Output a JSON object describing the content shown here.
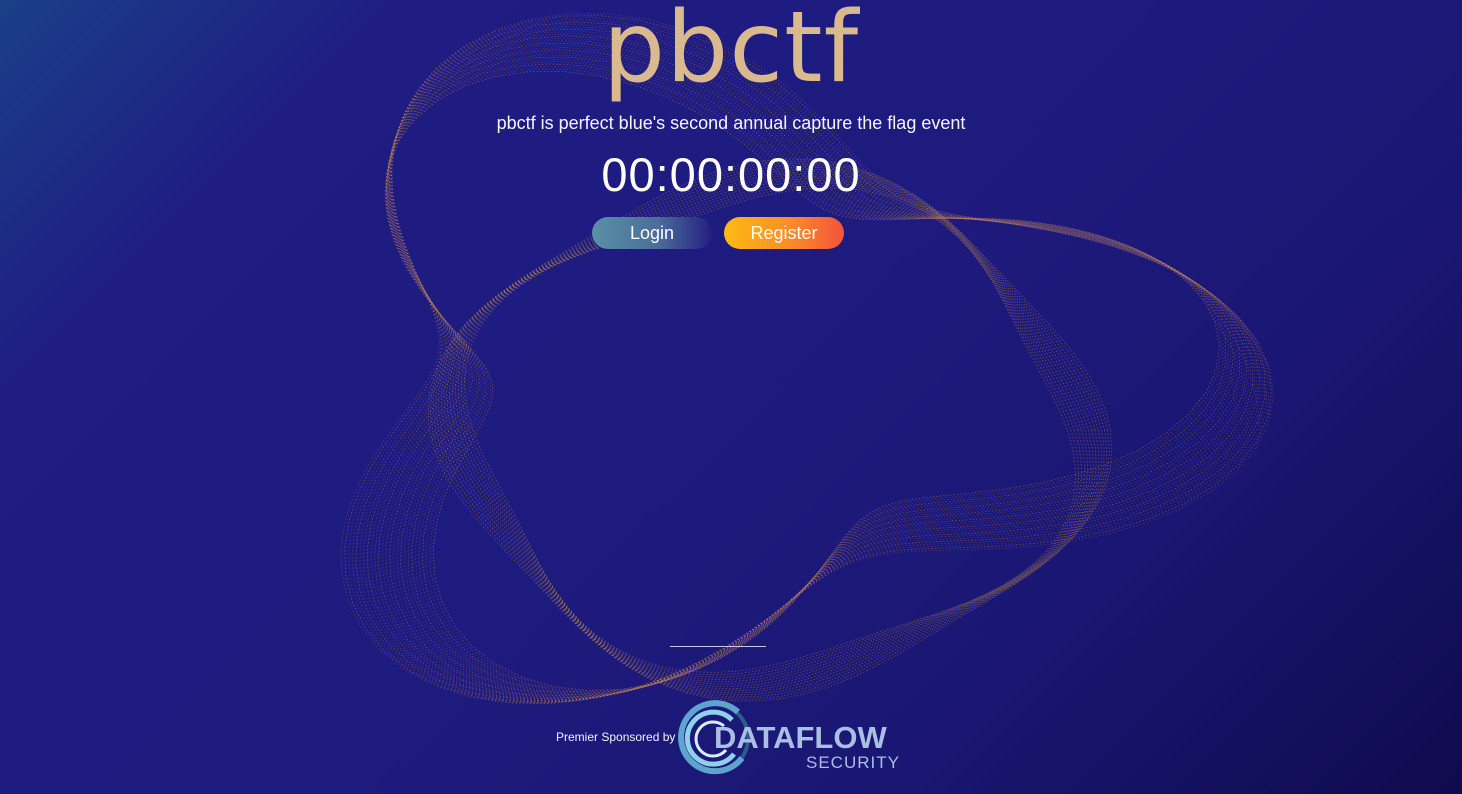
{
  "hero": {
    "title": "pbctf",
    "subtitle": "pbctf is perfect blue's second annual capture the flag event",
    "countdown": "00:00:00:00"
  },
  "actions": {
    "login_label": "Login",
    "register_label": "Register"
  },
  "sponsor": {
    "label": "Premier Sponsored by",
    "logo_name": "DATAFLOW",
    "logo_sub": "SECURITY"
  },
  "colors": {
    "background": "#1e1b7e",
    "title": "#d9b98d",
    "register_accent": "#fcbb13",
    "login_accent": "#5a8fa6"
  }
}
